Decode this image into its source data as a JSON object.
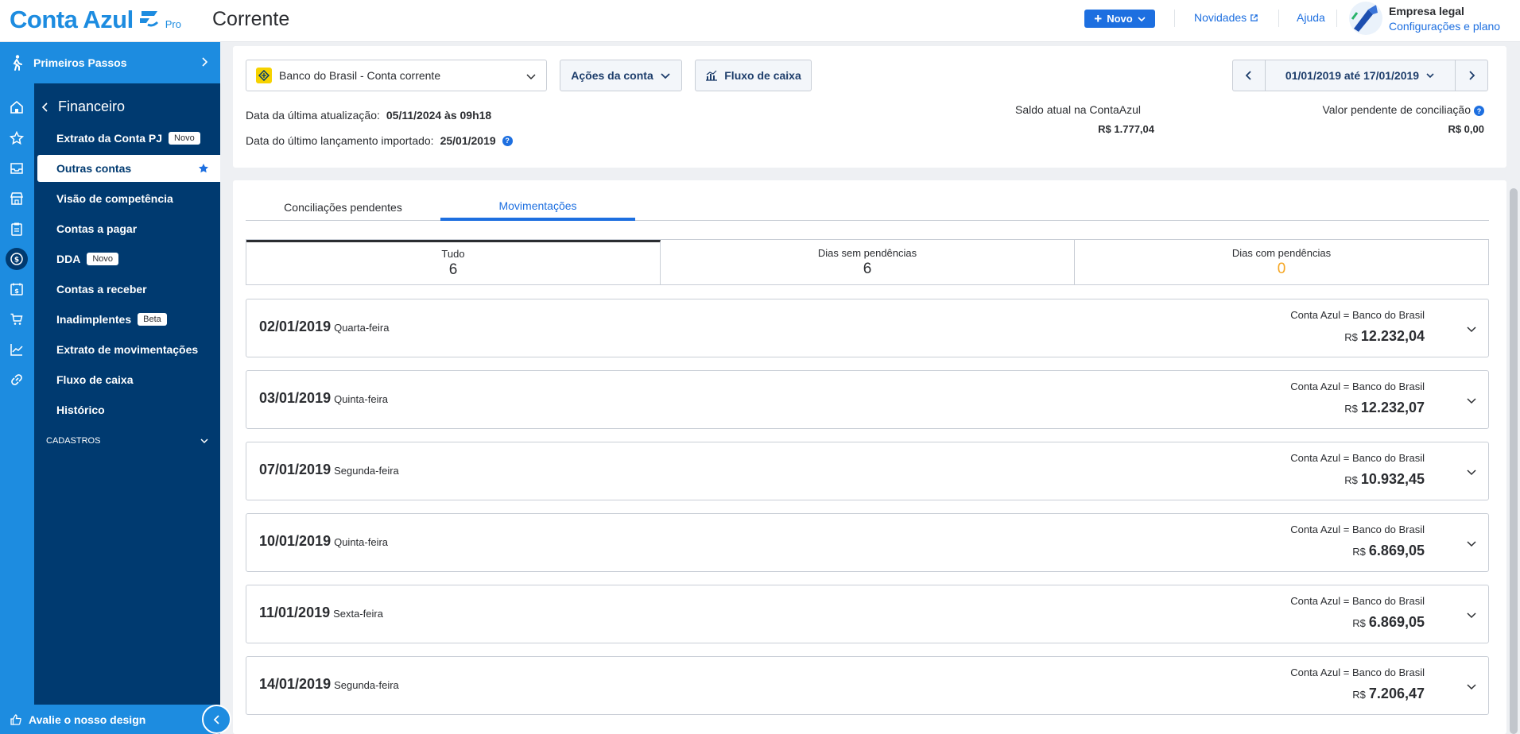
{
  "brand": {
    "name": "Conta Azul",
    "tier": "Pro"
  },
  "page": {
    "title": "Corrente"
  },
  "header": {
    "new_button": "Novo",
    "news_link": "Novidades",
    "help_link": "Ajuda",
    "company_name": "Empresa legal",
    "company_sub": "Configurações e plano"
  },
  "sidebar": {
    "first_steps": "Primeiros Passos",
    "section_title": "Financeiro",
    "items": [
      {
        "label": "Extrato da Conta PJ",
        "badge": "Novo"
      },
      {
        "label": "Outras contas"
      },
      {
        "label": "Visão de competência"
      },
      {
        "label": "Contas a pagar"
      },
      {
        "label": "DDA",
        "badge": "Novo"
      },
      {
        "label": "Contas a receber"
      },
      {
        "label": "Inadimplentes",
        "badge": "Beta"
      },
      {
        "label": "Extrato de movimentações"
      },
      {
        "label": "Fluxo de caixa"
      },
      {
        "label": "Histórico"
      }
    ],
    "cadastros": "CADASTROS",
    "feedback": "Avalie o nosso design"
  },
  "account": {
    "selected": "Banco do Brasil - Conta corrente",
    "actions_button": "Ações da conta",
    "cashflow_button": "Fluxo de caixa",
    "last_update_label": "Data da última atualização:",
    "last_update_value": "05/11/2024 às 09h18",
    "last_import_label": "Data do último lançamento importado:",
    "last_import_value": "25/01/2019",
    "date_range": "01/01/2019 até 17/01/2019",
    "balance_label": "Saldo atual na ContaAzul",
    "balance_value": "R$ 1.777,04",
    "pending_label": "Valor pendente de conciliação",
    "pending_value": "R$ 0,00"
  },
  "tabs": [
    {
      "label": "Conciliações pendentes"
    },
    {
      "label": "Movimentações"
    }
  ],
  "filters": [
    {
      "label": "Tudo",
      "count": "6"
    },
    {
      "label": "Dias sem pendências",
      "count": "6"
    },
    {
      "label": "Dias com pendências",
      "count": "0"
    }
  ],
  "days": [
    {
      "date": "02/01/2019",
      "weekday": "Quarta-feira",
      "status": "Conta Azul = Banco do Brasil",
      "currency": "R$",
      "amount": "12.232,04"
    },
    {
      "date": "03/01/2019",
      "weekday": "Quinta-feira",
      "status": "Conta Azul = Banco do Brasil",
      "currency": "R$",
      "amount": "12.232,07"
    },
    {
      "date": "07/01/2019",
      "weekday": "Segunda-feira",
      "status": "Conta Azul = Banco do Brasil",
      "currency": "R$",
      "amount": "10.932,45"
    },
    {
      "date": "10/01/2019",
      "weekday": "Quinta-feira",
      "status": "Conta Azul = Banco do Brasil",
      "currency": "R$",
      "amount": "6.869,05"
    },
    {
      "date": "11/01/2019",
      "weekday": "Sexta-feira",
      "status": "Conta Azul = Banco do Brasil",
      "currency": "R$",
      "amount": "6.869,05"
    },
    {
      "date": "14/01/2019",
      "weekday": "Segunda-feira",
      "status": "Conta Azul = Banco do Brasil",
      "currency": "R$",
      "amount": "7.206,47"
    }
  ],
  "colors": {
    "brand_blue": "#1d8ce0",
    "nav_dark": "#003a70",
    "accent": "#1d6fe0",
    "pending_orange": "#f5a623"
  }
}
